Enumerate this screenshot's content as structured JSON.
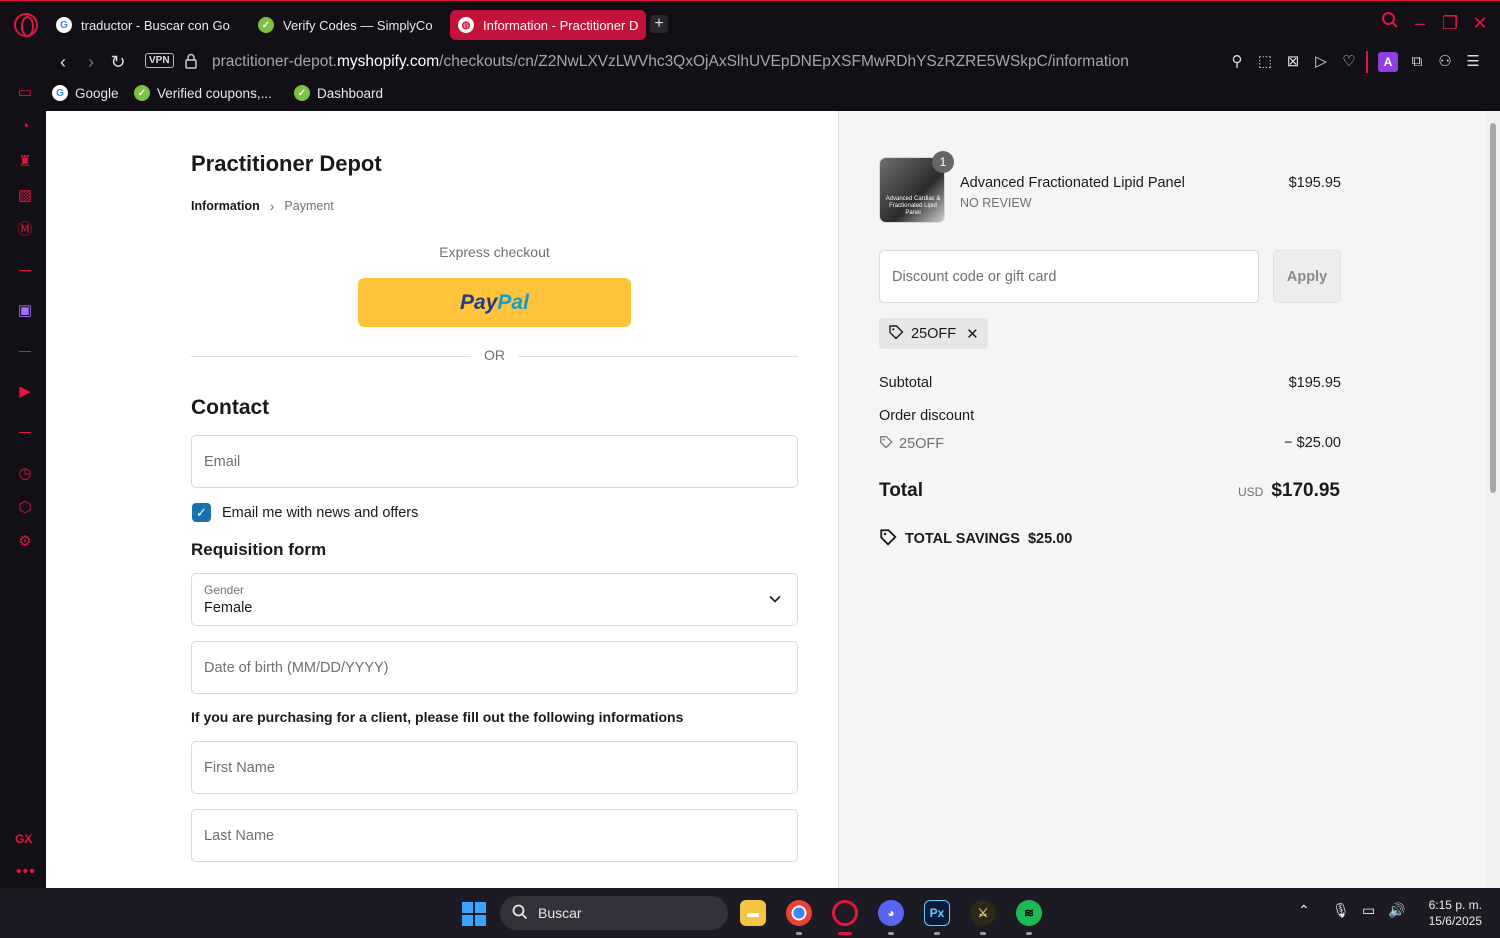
{
  "browser": {
    "tabs": [
      {
        "title": "traductor - Buscar con Go",
        "active": false,
        "favicon": "google-icon"
      },
      {
        "title": "Verify Codes — SimplyCo",
        "active": false,
        "favicon": "simplycodes-icon"
      },
      {
        "title": "Information - Practitioner D",
        "active": true,
        "favicon": "globe-icon"
      }
    ],
    "vpn_label": "VPN",
    "url_prefix": "practitioner-depot.",
    "url_domain": "myshopify.com",
    "url_path": "/checkouts/cn/Z2NwLXVzLWVhc3QxOjAxSlhUVEpDNEpXSFMwRDhYSzRZRE5WSkpC/information",
    "bookmarks": [
      {
        "label": "Google",
        "icon": "google-icon"
      },
      {
        "label": "Verified coupons,...",
        "icon": "simplycodes-icon"
      },
      {
        "label": "Dashboard",
        "icon": "simplycodes-icon"
      }
    ],
    "accent": "#e5143e"
  },
  "checkout": {
    "store_name": "Practitioner Depot",
    "breadcrumb": {
      "current": "Information",
      "next": "Payment"
    },
    "express_label": "Express checkout",
    "paypal": {
      "pay": "Pay",
      "pal": "Pal"
    },
    "or_label": "OR",
    "contact_heading": "Contact",
    "email_placeholder": "Email",
    "news_checkbox_label": "Email me with news and offers",
    "news_checked": true,
    "requisition_heading": "Requisition form",
    "gender": {
      "label": "Gender",
      "value": "Female"
    },
    "dob_placeholder": "Date of birth (MM/DD/YYYY)",
    "client_note": "If you are purchasing for a client, please fill out the following informations",
    "first_name_placeholder": "First Name",
    "last_name_placeholder": "Last Name",
    "primary_color": "#1773b0"
  },
  "summary": {
    "product": {
      "name": "Advanced Fractionated Lipid Panel",
      "subtitle": "NO REVIEW",
      "price": "$195.95",
      "quantity": "1",
      "thumb_text": "Advanced Cardiac & Fractionated Lipid Panel"
    },
    "discount_placeholder": "Discount code or gift card",
    "apply_label": "Apply",
    "applied_code": "25OFF",
    "subtotal_label": "Subtotal",
    "subtotal_value": "$195.95",
    "order_discount_label": "Order discount",
    "discount_code": "25OFF",
    "discount_value": "− $25.00",
    "total_label": "Total",
    "total_currency": "USD",
    "total_value": "$170.95",
    "savings_label": "TOTAL SAVINGS",
    "savings_value": "$25.00"
  },
  "taskbar": {
    "search_label": "Buscar",
    "time": "6:15 p. m.",
    "date": "15/6/2025"
  }
}
